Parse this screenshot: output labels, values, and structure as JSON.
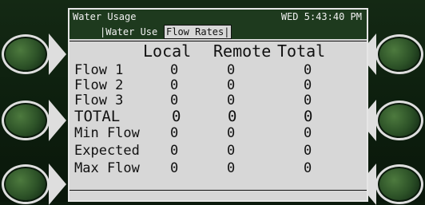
{
  "header": {
    "title": "Water Usage",
    "clock": "WED 5:43:40 PM"
  },
  "tabs": [
    {
      "label": "|Water Use"
    },
    {
      "label": "Flow Rates|"
    }
  ],
  "table": {
    "columns": [
      "Local",
      "Remote",
      "Total"
    ],
    "rows": [
      {
        "label": "Flow 1",
        "local": "0",
        "remote": "0",
        "total": "0"
      },
      {
        "label": "Flow 2",
        "local": "0",
        "remote": "0",
        "total": "0"
      },
      {
        "label": "Flow 3",
        "local": "0",
        "remote": "0",
        "total": "0"
      },
      {
        "label": "TOTAL",
        "local": "0",
        "remote": "0",
        "total": "0"
      },
      {
        "label": "Min Flow",
        "local": "0",
        "remote": "0",
        "total": "0"
      },
      {
        "label": "Expected",
        "local": "0",
        "remote": "0",
        "total": "0"
      },
      {
        "label": "Max Flow",
        "local": "0",
        "remote": "0",
        "total": "0"
      }
    ]
  },
  "colors": {
    "bezel": "#0b1a0c",
    "screen": "#d7d7d7",
    "header_bar": "#1e3a1e",
    "button_green": "#2c5127"
  }
}
